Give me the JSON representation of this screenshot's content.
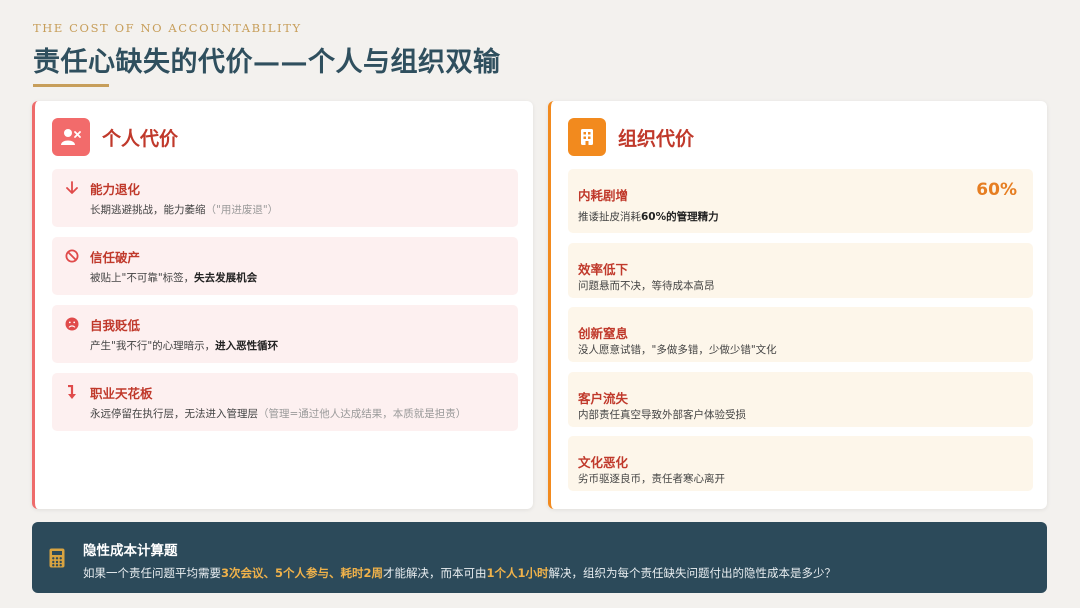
{
  "header": {
    "eyebrow": "THE COST OF NO ACCOUNTABILITY",
    "title": "责任心缺失的代价——个人与组织双输"
  },
  "personal": {
    "title": "个人代价",
    "icon": "user-remove-icon",
    "items": [
      {
        "icon": "arrow-down-icon",
        "title": "能力退化",
        "desc_a": "长期逃避挑战，能力萎缩",
        "desc_muted": "（\"用进废退\"）"
      },
      {
        "icon": "ban-icon",
        "title": "信任破产",
        "desc_a": "被贴上\"不可靠\"标签，",
        "desc_bold": "失去发展机会"
      },
      {
        "icon": "sad-face-icon",
        "title": "自我贬低",
        "desc_a": "产生\"我不行\"的心理暗示，",
        "desc_bold": "进入恶性循环"
      },
      {
        "icon": "arrow-turn-down-icon",
        "title": "职业天花板",
        "desc_a": "永远停留在执行层，无法进入管理层",
        "desc_muted": "（管理=通过他人达成结果，本质就是担责）"
      }
    ]
  },
  "organization": {
    "title": "组织代价",
    "icon": "building-icon",
    "items": [
      {
        "title": "内耗剧增",
        "stat": "60%",
        "desc_a": "推诿扯皮消耗",
        "desc_bold": "60%的管理精力"
      },
      {
        "title": "效率低下",
        "desc_a": "问题悬而不决，等待成本高昂"
      },
      {
        "title": "创新窒息",
        "desc_a": "没人愿意试错，\"多做多错，少做少错\"文化"
      },
      {
        "title": "客户流失",
        "desc_a": "内部责任真空导致外部客户体验受损"
      },
      {
        "title": "文化恶化",
        "desc_a": "劣币驱逐良币，责任者寒心离开"
      }
    ]
  },
  "calc": {
    "icon": "calculator-icon",
    "title": "隐性成本计算题",
    "q_1": "如果一个责任问题平均需要",
    "q_hl1": "3次会议、5个人参与、耗时2周",
    "q_2": "才能解决，而本可由",
    "q_hl2": "1个人1小时",
    "q_3": "解决，组织为每个责任缺失问题付出的隐性成本是多少？"
  },
  "colors": {
    "accent_gold": "#c79e5a",
    "title_navy": "#2f4f5e",
    "personal_red": "#f26b6b",
    "org_orange": "#f28a1e",
    "footer_bg": "#2c4a5a"
  }
}
